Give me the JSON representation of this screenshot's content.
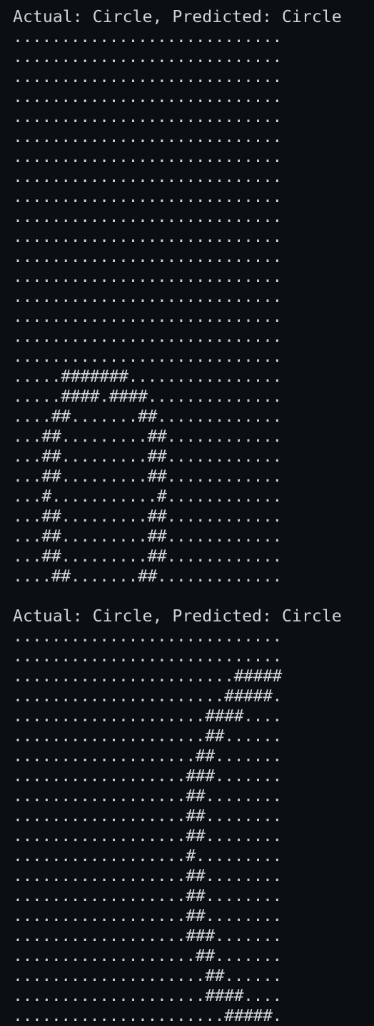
{
  "terminal": {
    "blocks": [
      {
        "header": "Actual: Circle, Predicted: Circle",
        "rows": [
          "............................",
          "............................",
          "............................",
          "............................",
          "............................",
          "............................",
          "............................",
          "............................",
          "............................",
          "............................",
          "............................",
          "............................",
          "............................",
          "............................",
          "............................",
          "............................",
          "............................",
          ".....#######................",
          ".....####.####..............",
          "....##.......##.............",
          "...##.........##............",
          "...##.........##............",
          "...##.........##............",
          "...#...........#............",
          "...##.........##............",
          "...##.........##............",
          "...##.........##............",
          "....##.......##............."
        ]
      },
      {
        "header": "Actual: Circle, Predicted: Circle",
        "rows": [
          "............................",
          "............................",
          ".......................#####",
          "......................#####.",
          "....................####....",
          "....................##......",
          "...................##.......",
          "..................###.......",
          "..................##........",
          "..................##........",
          "..................##........",
          "..................#.........",
          "..................##........",
          "..................##........",
          "..................##........",
          "..................###.......",
          "...................##.......",
          "....................##......",
          "....................####....",
          "......................#####."
        ]
      }
    ]
  }
}
